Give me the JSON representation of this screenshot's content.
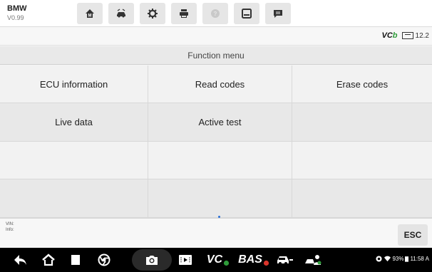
{
  "header": {
    "brand": "BMW",
    "version": "V0.99",
    "tools": [
      {
        "icon": "home-icon"
      },
      {
        "icon": "vehicle-swap-icon"
      },
      {
        "icon": "settings-gear-icon"
      },
      {
        "icon": "print-icon"
      },
      {
        "icon": "help-icon"
      },
      {
        "icon": "save-icon"
      },
      {
        "icon": "message-icon"
      }
    ]
  },
  "status": {
    "vci_prefix": "VC",
    "vci_suffix": "b",
    "voltage": "12.2"
  },
  "menu": {
    "title": "Function menu",
    "items": [
      "ECU information",
      "Read codes",
      "Erase codes",
      "Live data",
      "Active test",
      "",
      "",
      "",
      "",
      "",
      "",
      ""
    ]
  },
  "info": {
    "vin_label": "VIN:",
    "info_label": "Info:",
    "esc_label": "ESC"
  },
  "navbar": {
    "vci_text": "VC",
    "bas_text": "BAS",
    "battery": "93%",
    "time": "11:58 A"
  },
  "colors": {
    "accent_green": "#2e9b3a",
    "header_bg": "#ffffff",
    "navbar_bg": "#000000"
  }
}
